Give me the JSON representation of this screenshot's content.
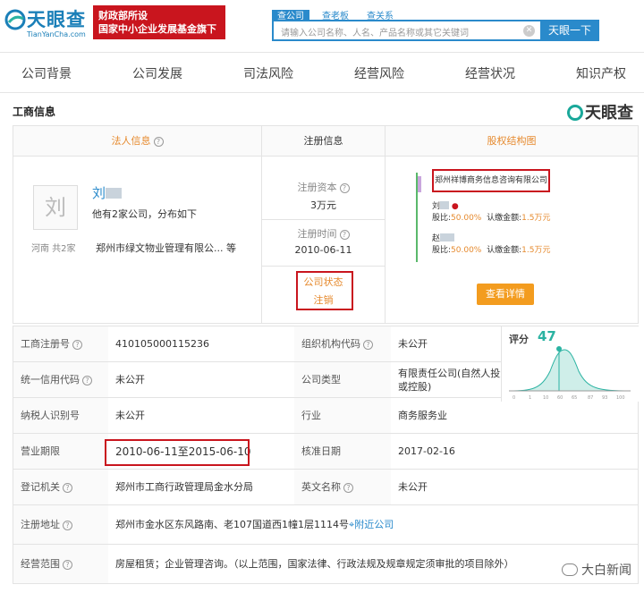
{
  "brand": {
    "name": "天眼查",
    "domain": "TianYanCha.com",
    "banner_line1": "财政部所设",
    "banner_line2": "国家中小企业发展基金旗下"
  },
  "search": {
    "tabs": [
      "查公司",
      "查老板",
      "查关系"
    ],
    "placeholder": "请输入公司名称、人名、产品名称或其它关键词",
    "button": "天眼一下"
  },
  "nav": [
    "公司背景",
    "公司发展",
    "司法风险",
    "经营风险",
    "经营状况",
    "知识产权"
  ],
  "section": {
    "title": "工商信息",
    "watermark": "天眼查"
  },
  "legal": {
    "header": "法人信息",
    "avatar": "刘",
    "name": "刘",
    "count_text": "他有2家公司，分布如下",
    "location": "河南  共2家",
    "company": "郑州市绿文物业管理有限公...  等"
  },
  "registration": {
    "header": "注册信息",
    "capital_label": "注册资本",
    "capital": "3万元",
    "time_label": "注册时间",
    "time": "2010-06-11",
    "status_label": "公司状态",
    "status": "注销"
  },
  "equity": {
    "header": "股权结构图",
    "company": "郑州祥博商务信息咨询有限公司",
    "holders": [
      {
        "name": "刘",
        "share_label": "股比:",
        "share": "50.00%",
        "paid_label": "认缴金额:",
        "paid": "1.5万元"
      },
      {
        "name": "赵",
        "share_label": "股比:",
        "share": "50.00%",
        "paid_label": "认缴金额:",
        "paid": "1.5万元"
      }
    ],
    "button": "查看详情"
  },
  "score": {
    "label": "评分",
    "value": "47",
    "ticks": [
      "0",
      "1",
      "10",
      "60",
      "65",
      "87",
      "93",
      "100"
    ]
  },
  "rows": [
    {
      "l1": "工商注册号",
      "v1": "410105000115236",
      "l2": "组织机构代码",
      "v2": "未公开"
    },
    {
      "l1": "统一信用代码",
      "v1": "未公开",
      "l2": "公司类型",
      "v2": "有限责任公司(自然人投资或控股)"
    },
    {
      "l1": "纳税人识别号",
      "v1": "未公开",
      "l2": "行业",
      "v2": "商务服务业"
    },
    {
      "l1": "营业期限",
      "v1": "2010-06-11至2015-06-10",
      "l2": "核准日期",
      "v2": "2017-02-16"
    },
    {
      "l1": "登记机关",
      "v1": "郑州市工商行政管理局金水分局",
      "l2": "英文名称",
      "v2": "未公开"
    }
  ],
  "address": {
    "label": "注册地址",
    "value": "郑州市金水区东风路南、老107国道西1幢1层1114号",
    "link": "附近公司"
  },
  "scope": {
    "label": "经营范围",
    "value": "房屋租赁；企业管理咨询。（以上范围，国家法律、行政法规及规章规定须审批的项目除外）"
  },
  "footer": "大白新闻"
}
